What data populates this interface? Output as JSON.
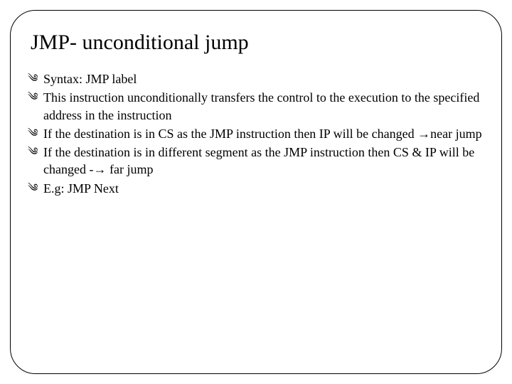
{
  "title": "JMP- unconditional jump",
  "bullets": [
    "Syntax: JMP label",
    "This instruction unconditionally transfers the control to the execution to the specified address in the instruction",
    "If the destination is in CS as the JMP instruction then IP will be changed →near jump",
    "If the destination is in different segment as the JMP instruction then CS & IP will be changed -→ far jump",
    "E.g: JMP Next"
  ],
  "bullet_icon": "༄",
  "page_number": ""
}
